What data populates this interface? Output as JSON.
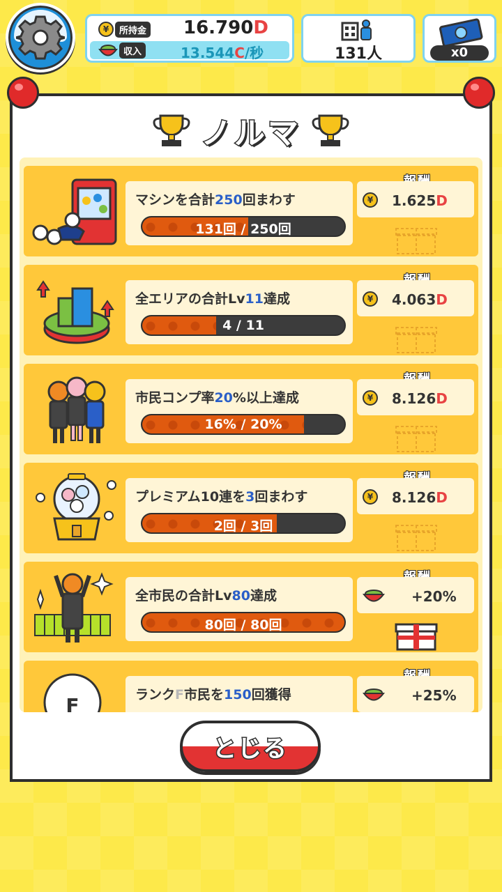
{
  "topbar": {
    "money_label": "所持金",
    "money_value": "16.790",
    "money_unit": "D",
    "income_label": "収入",
    "income_value": "13.544",
    "income_unit": "C",
    "income_per": "/秒",
    "population": "131人",
    "tickets": "x0"
  },
  "panel": {
    "title": "ノルマ",
    "reward_label": "報酬",
    "tasks": [
      {
        "desc_a": "マシンを合計",
        "desc_hl": "250",
        "desc_b": "回まわす",
        "progress_text": "131回 / 250回",
        "progress": 0.524,
        "reward_value": "1.625",
        "reward_unit": "D",
        "reward_type": "coin",
        "gift": "outline"
      },
      {
        "desc_a": "全エリアの合計Lv",
        "desc_hl": "11",
        "desc_b": "達成",
        "progress_text": "4 / 11",
        "progress": 0.364,
        "reward_value": "4.063",
        "reward_unit": "D",
        "reward_type": "coin",
        "gift": "outline"
      },
      {
        "desc_a": "市民コンプ率",
        "desc_hl": "20",
        "desc_b": "%以上達成",
        "progress_text": "16% / 20%",
        "progress": 0.8,
        "reward_value": "8.126",
        "reward_unit": "D",
        "reward_type": "coin",
        "gift": "outline"
      },
      {
        "desc_a": "プレミアム10連を",
        "desc_hl": "3",
        "desc_b": "回まわす",
        "progress_text": "2回 / 3回",
        "progress": 0.667,
        "reward_value": "8.126",
        "reward_unit": "D",
        "reward_type": "coin",
        "gift": "outline"
      },
      {
        "desc_a": "全市民の合計Lv",
        "desc_hl": "80",
        "desc_b": "達成",
        "progress_text": "80回 / 80回",
        "progress": 1.0,
        "reward_value": "+20%",
        "reward_unit": "",
        "reward_type": "bowl",
        "gift": "full"
      },
      {
        "desc_a": "ランク",
        "desc_hl": "F",
        "desc_b": "市民を",
        "desc_hl2": "150",
        "desc_c": "回獲得",
        "reward_value": "+25%",
        "reward_unit": "",
        "reward_type": "bowl",
        "gift": "outline"
      }
    ]
  },
  "close_button": "とじる",
  "colors": {
    "background": "#fde94a",
    "card": "#ffc83a",
    "progress_fill": "#e05a0f",
    "highlight_blue": "#2a5fc8",
    "currency_red": "#e84343",
    "close_red": "#e23333"
  }
}
